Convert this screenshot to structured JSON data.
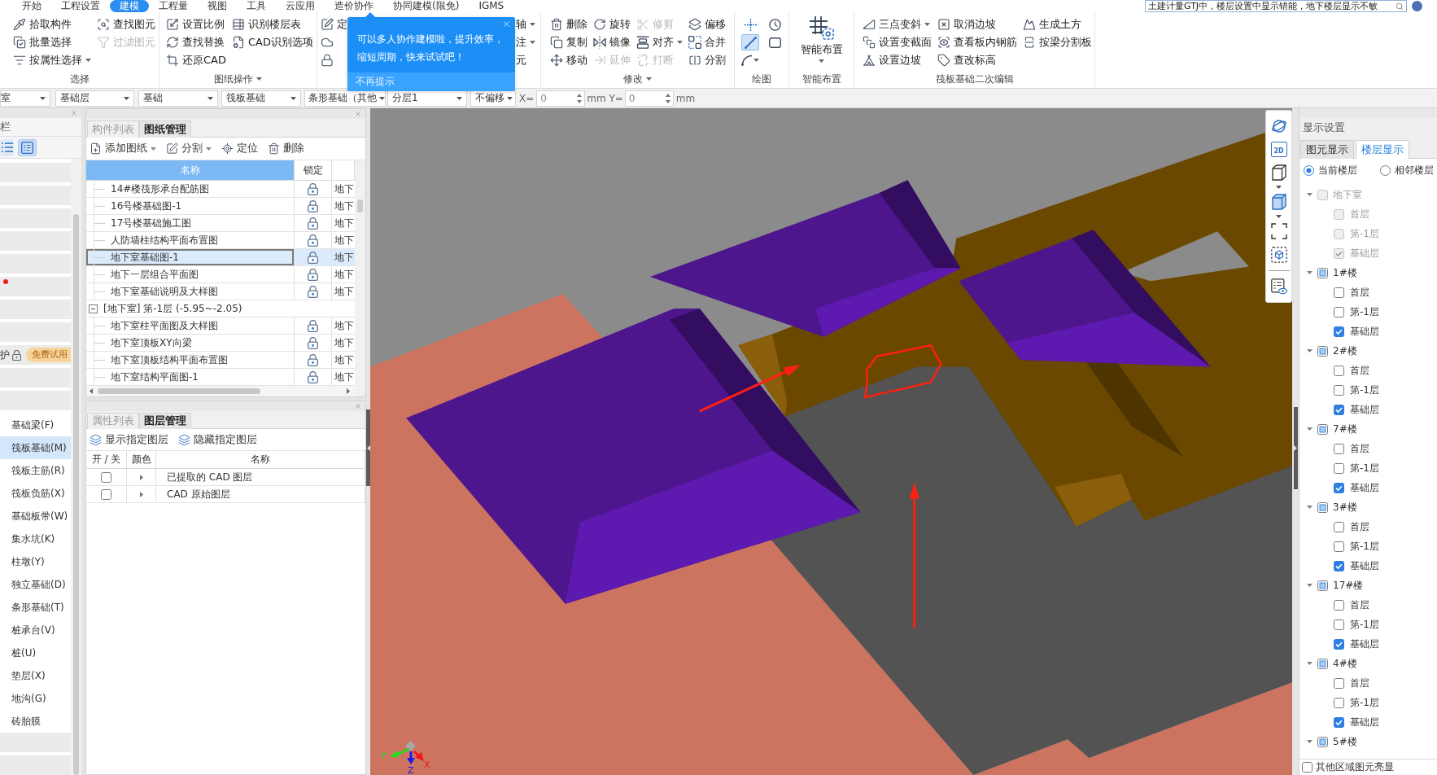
{
  "menu_tabs": [
    {
      "label": "开始",
      "selected": false
    },
    {
      "label": "工程设置",
      "selected": false
    },
    {
      "label": "建模",
      "selected": true
    },
    {
      "label": "工程量",
      "selected": false
    },
    {
      "label": "视图",
      "selected": false
    },
    {
      "label": "工具",
      "selected": false
    },
    {
      "label": "云应用",
      "selected": false
    },
    {
      "label": "造价协作",
      "selected": false
    },
    {
      "label": "协同建模(限免)",
      "selected": false
    },
    {
      "label": "IGMS",
      "selected": false
    }
  ],
  "help_search": {
    "value": "土建计量GTJ中，楼层设置中显示错能，地下楼层显示不敏"
  },
  "ribbon": {
    "groups": [
      {
        "kind": "buttons",
        "label": "选择",
        "dropdown": false,
        "items": [
          {
            "label": "拾取构件",
            "disabled": false,
            "dropdown": false
          },
          {
            "label": "批量选择",
            "disabled": false,
            "dropdown": false
          },
          {
            "label": "按属性选择",
            "disabled": false,
            "dropdown": true
          },
          {
            "label": "查找图元",
            "disabled": false,
            "dropdown": false
          },
          {
            "label": "过滤图元",
            "disabled": true,
            "dropdown": false
          }
        ]
      },
      {
        "kind": "buttons",
        "label": "图纸操作",
        "dropdown": true,
        "items": [
          {
            "label": "设置比例",
            "disabled": false,
            "dropdown": false
          },
          {
            "label": "查找替换",
            "disabled": false,
            "dropdown": false
          },
          {
            "label": "还原CAD",
            "disabled": false,
            "dropdown": false
          },
          {
            "label": "识别楼层表",
            "disabled": false,
            "dropdown": false
          },
          {
            "label": "CAD识别选项",
            "disabled": false,
            "dropdown": false
          }
        ]
      },
      {
        "kind": "buttons",
        "items": [
          {
            "label": "定",
            "disabled": false,
            "dropdown": false
          },
          {
            "disabled": false,
            "dropdown": false
          },
          {
            "disabled": false,
            "dropdown": false
          },
          {
            "label": "轴",
            "disabled": false,
            "dropdown": true
          },
          {
            "label": "注",
            "disabled": false,
            "dropdown": true
          },
          {
            "label": "元",
            "disabled": false,
            "dropdown": false
          }
        ]
      },
      {
        "kind": "buttons",
        "label": "修改",
        "dropdown": true,
        "items": [
          {
            "label": "删除",
            "disabled": false,
            "dropdown": false
          },
          {
            "label": "复制",
            "disabled": false,
            "dropdown": false
          },
          {
            "label": "移动",
            "disabled": false,
            "dropdown": false
          },
          {
            "label": "旋转",
            "disabled": false,
            "dropdown": false
          },
          {
            "label": "镜像",
            "disabled": false,
            "dropdown": false
          },
          {
            "label": "延伸",
            "disabled": true,
            "dropdown": false
          },
          {
            "label": "修剪",
            "disabled": true,
            "dropdown": false
          },
          {
            "label": "对齐",
            "disabled": false,
            "dropdown": true
          },
          {
            "label": "打断",
            "disabled": true,
            "dropdown": false
          },
          {
            "label": "偏移",
            "disabled": false,
            "dropdown": false
          },
          {
            "label": "合并",
            "disabled": false,
            "dropdown": false
          },
          {
            "label": "分割",
            "disabled": false,
            "dropdown": false
          }
        ]
      },
      {
        "kind": "tools",
        "label": "绘图",
        "dropdown": false,
        "items": [
          {
            "selected": false,
            "dropdown": false
          },
          {
            "selected": true,
            "dropdown": false
          },
          {
            "selected": false,
            "dropdown": true
          },
          {
            "selected": false,
            "dropdown": false
          },
          {
            "selected": false,
            "dropdown": false
          }
        ]
      },
      {
        "kind": "big",
        "label": "智能布置",
        "dropdown": false,
        "items": [
          {
            "label": "智能布置",
            "dropdown": true
          }
        ]
      },
      {
        "kind": "buttons",
        "label": "筏板基础二次编辑",
        "dropdown": false,
        "items": [
          {
            "label": "三点变斜",
            "disabled": false,
            "dropdown": true
          },
          {
            "label": "设置变截面",
            "disabled": false,
            "dropdown": false
          },
          {
            "label": "设置边坡",
            "disabled": false,
            "dropdown": false
          },
          {
            "label": "取消边坡",
            "disabled": false,
            "dropdown": false
          },
          {
            "label": "查看板内钢筋",
            "disabled": false,
            "dropdown": false
          },
          {
            "label": "查改标高",
            "disabled": false,
            "dropdown": false
          },
          {
            "label": "生成土方",
            "disabled": false,
            "dropdown": false
          },
          {
            "label": "按梁分割板",
            "disabled": false,
            "dropdown": false
          }
        ]
      }
    ]
  },
  "tip": {
    "message": "可以多人协作建模啦，提升效率，缩短周期，快来试试吧！",
    "dismiss": "不再提示"
  },
  "selectors": [
    {
      "value": "室"
    },
    {
      "value": "基础层"
    },
    {
      "value": "基础"
    },
    {
      "value": "筏板基础"
    },
    {
      "value": "条形基础（其他"
    },
    {
      "value": "分层1"
    },
    {
      "value": "不偏移"
    }
  ],
  "offset": {
    "x_label": "X=",
    "x_value": "0",
    "y_label": "mm Y=",
    "y_value": "0",
    "unit": "mm"
  },
  "nav": {
    "title": "栏",
    "view_toggles": [
      {
        "selected": false
      },
      {
        "selected": true
      }
    ],
    "categories": [
      {
        "new": false,
        "locked": false
      },
      {
        "new": false,
        "locked": false
      },
      {
        "new": false,
        "locked": false
      },
      {
        "new": false,
        "locked": false
      },
      {
        "new": false,
        "locked": false
      },
      {
        "new": true,
        "locked": false
      },
      {
        "new": false,
        "locked": false
      },
      {
        "new": false,
        "locked": false
      },
      {
        "label": "护",
        "new": false,
        "locked": true,
        "badge": "免费试用"
      },
      {
        "new": false,
        "locked": false
      },
      {
        "new": false,
        "locked": false,
        "children": [
          {
            "label": "基础梁(F)",
            "selected": false
          },
          {
            "label": "筏板基础(M)",
            "selected": true
          },
          {
            "label": "筏板主筋(R)",
            "selected": false
          },
          {
            "label": "筏板负筋(X)",
            "selected": false
          },
          {
            "label": "基础板带(W)",
            "selected": false
          },
          {
            "label": "集水坑(K)",
            "selected": false
          },
          {
            "label": "柱墩(Y)",
            "selected": false
          },
          {
            "label": "独立基础(D)",
            "selected": false
          },
          {
            "label": "条形基础(T)",
            "selected": false
          },
          {
            "label": "桩承台(V)",
            "selected": false
          },
          {
            "label": "桩(U)",
            "selected": false
          },
          {
            "label": "垫层(X)",
            "selected": false
          },
          {
            "label": "地沟(G)",
            "selected": false
          },
          {
            "label": "砖胎膜",
            "selected": false
          }
        ]
      },
      {
        "new": false,
        "locked": false
      },
      {
        "new": false,
        "locked": false
      }
    ]
  },
  "drawing_panel": {
    "tabs": [
      {
        "label": "构件列表",
        "selected": false
      },
      {
        "label": "图纸管理",
        "selected": true
      }
    ],
    "actions": [
      {
        "label": "添加图纸",
        "dropdown": true
      },
      {
        "label": "分割",
        "dropdown": true
      },
      {
        "label": "定位",
        "dropdown": false
      },
      {
        "label": "删除",
        "dropdown": false
      }
    ],
    "columns": [
      "名称",
      "锁定"
    ],
    "groups": [
      {
        "rows": [
          {
            "name": "14#楼筏形承台配筋图",
            "column_3": "地下",
            "selected": false
          },
          {
            "name": "16号楼基础图-1",
            "column_3": "地下",
            "selected": false
          },
          {
            "name": "17号楼基础施工图",
            "column_3": "地下",
            "selected": false
          },
          {
            "name": "人防墙柱结构平面布置图",
            "column_3": "地下",
            "selected": false
          },
          {
            "name": "地下室基础图-1",
            "column_3": "地下",
            "selected": true
          },
          {
            "name": "地下一层组合平面图",
            "column_3": "地下",
            "selected": false
          },
          {
            "name": "地下室基础说明及大样图",
            "column_3": "地下",
            "selected": false
          }
        ]
      },
      {
        "label": "[地下室] 第-1层 (-5.95~-2.05)",
        "expanded": true,
        "rows": [
          {
            "name": "地下室柱平面图及大样图",
            "column_3": "地下",
            "selected": false
          },
          {
            "name": "地下室顶板XY向梁",
            "column_3": "地下",
            "selected": false
          },
          {
            "name": "地下室顶板结构平面布置图",
            "column_3": "地下",
            "selected": false
          },
          {
            "name": "地下室结构平面图-1",
            "column_3": "地下",
            "selected": false
          }
        ]
      }
    ]
  },
  "layer_panel": {
    "tabs": [
      {
        "label": "属性列表",
        "selected": false
      },
      {
        "label": "图层管理",
        "selected": true
      }
    ],
    "actions": [
      {
        "label": "显示指定图层"
      },
      {
        "label": "隐藏指定图层"
      }
    ],
    "columns": [
      "开 / 关",
      "颜色",
      "名称"
    ],
    "rows": [
      {
        "on": false,
        "expanded": false,
        "name": "已提取的 CAD 图层"
      },
      {
        "on": false,
        "expanded": false,
        "name": "CAD 原始图层"
      }
    ]
  },
  "view": {
    "toolbar": [
      {
        "kind": "orbit",
        "dropdown": false
      },
      {
        "kind": "plan",
        "label": "2D",
        "dropdown": false
      },
      {
        "kind": "wireframe",
        "dropdown": true
      },
      {
        "kind": "shaded",
        "dropdown": true
      },
      {
        "kind": "corners",
        "dropdown": false
      },
      {
        "kind": "isolate",
        "dropdown": false
      },
      {
        "kind": "legend",
        "dropdown": false
      }
    ],
    "axes": {
      "x": "X",
      "y": "Y",
      "z": "Z"
    }
  },
  "display_settings": {
    "title": "显示设置",
    "tabs": [
      {
        "label": "图元显示",
        "selected": false
      },
      {
        "label": "楼层显示",
        "selected": true
      }
    ],
    "scope": [
      {
        "label": "当前楼层",
        "selected": true
      },
      {
        "label": "相邻楼层",
        "selected": false
      }
    ],
    "floors": [
      {
        "label": "地下室",
        "checked": false,
        "partial": false,
        "disabled": true,
        "expanded": true,
        "children": [
          {
            "label": "首层",
            "checked": false,
            "disabled": true
          },
          {
            "label": "第-1层",
            "checked": false,
            "disabled": true
          },
          {
            "label": "基础层",
            "checked": true,
            "disabled": true
          }
        ]
      },
      {
        "label": "1#楼",
        "checked": false,
        "partial": true,
        "disabled": false,
        "expanded": true,
        "children": [
          {
            "label": "首层",
            "checked": false,
            "disabled": false
          },
          {
            "label": "第-1层",
            "checked": false,
            "disabled": false
          },
          {
            "label": "基础层",
            "checked": true,
            "disabled": false
          }
        ]
      },
      {
        "label": "2#楼",
        "checked": false,
        "partial": true,
        "disabled": false,
        "expanded": true,
        "children": [
          {
            "label": "首层",
            "checked": false,
            "disabled": false
          },
          {
            "label": "第-1层",
            "checked": false,
            "disabled": false
          },
          {
            "label": "基础层",
            "checked": true,
            "disabled": false
          }
        ]
      },
      {
        "label": "7#楼",
        "checked": false,
        "partial": true,
        "disabled": false,
        "expanded": true,
        "children": [
          {
            "label": "首层",
            "checked": false,
            "disabled": false
          },
          {
            "label": "第-1层",
            "checked": false,
            "disabled": false
          },
          {
            "label": "基础层",
            "checked": true,
            "disabled": false
          }
        ]
      },
      {
        "label": "3#楼",
        "checked": false,
        "partial": true,
        "disabled": false,
        "expanded": true,
        "children": [
          {
            "label": "首层",
            "checked": false,
            "disabled": false
          },
          {
            "label": "第-1层",
            "checked": false,
            "disabled": false
          },
          {
            "label": "基础层",
            "checked": true,
            "disabled": false
          }
        ]
      },
      {
        "label": "17#楼",
        "checked": false,
        "partial": true,
        "disabled": false,
        "expanded": true,
        "children": [
          {
            "label": "首层",
            "checked": false,
            "disabled": false
          },
          {
            "label": "第-1层",
            "checked": false,
            "disabled": false
          },
          {
            "label": "基础层",
            "checked": true,
            "disabled": false
          }
        ]
      },
      {
        "label": "4#楼",
        "checked": false,
        "partial": true,
        "disabled": false,
        "expanded": true,
        "children": [
          {
            "label": "首层",
            "checked": false,
            "disabled": false
          },
          {
            "label": "第-1层",
            "checked": false,
            "disabled": false
          },
          {
            "label": "基础层",
            "checked": true,
            "disabled": false
          }
        ]
      },
      {
        "label": "5#楼",
        "checked": false,
        "partial": true,
        "disabled": false,
        "expanded": true
      }
    ],
    "highlight_others": {
      "label": "其他区域图元亮显",
      "checked": false
    }
  }
}
